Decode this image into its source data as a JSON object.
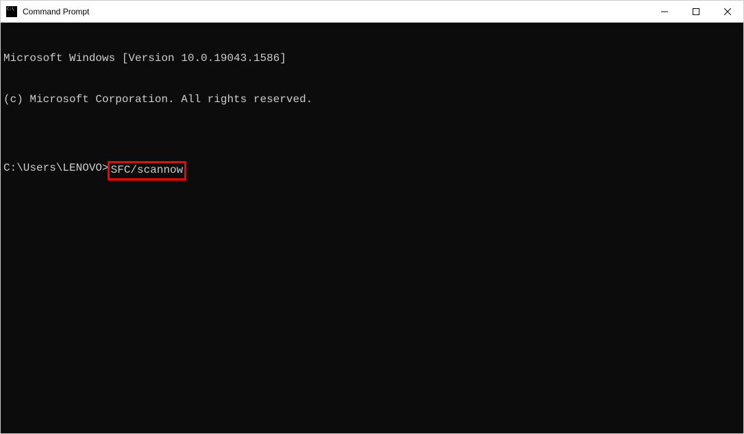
{
  "window": {
    "title": "Command Prompt"
  },
  "terminal": {
    "line1": "Microsoft Windows [Version 10.0.19043.1586]",
    "line2": "(c) Microsoft Corporation. All rights reserved.",
    "blank": "",
    "prompt": "C:\\Users\\LENOVO>",
    "command": "SFC/scannow"
  }
}
